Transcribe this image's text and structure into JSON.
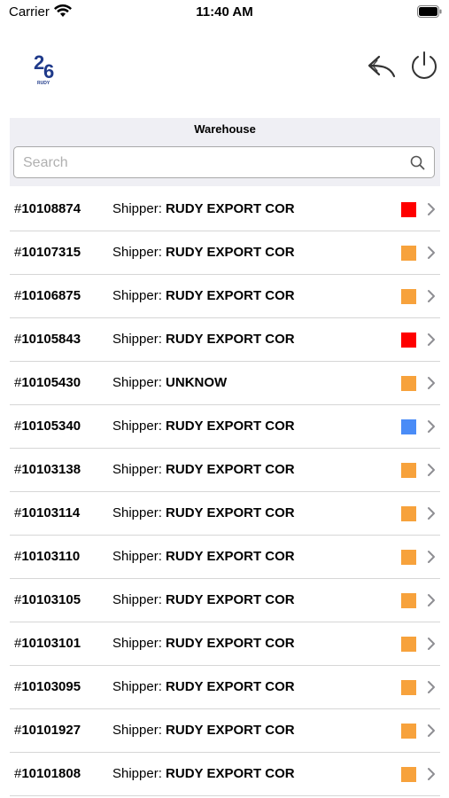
{
  "status_bar": {
    "carrier": "Carrier",
    "time": "11:40 AM"
  },
  "logo": {
    "text": "26",
    "sub": "RUDY"
  },
  "header": {
    "icons": [
      "reply-arrow-icon",
      "power-icon"
    ]
  },
  "section": {
    "title": "Warehouse"
  },
  "search": {
    "placeholder": "Search",
    "value": ""
  },
  "list": {
    "shipper_label": "Shipper:",
    "items": [
      {
        "hash": "#",
        "number": "10108874",
        "shipper": "RUDY EXPORT COR",
        "color": "#ff0000"
      },
      {
        "hash": "#",
        "number": "10107315",
        "shipper": "RUDY EXPORT COR",
        "color": "#f7a23c"
      },
      {
        "hash": "#",
        "number": "10106875",
        "shipper": "RUDY EXPORT COR",
        "color": "#f7a23c"
      },
      {
        "hash": "#",
        "number": "10105843",
        "shipper": "RUDY EXPORT COR",
        "color": "#ff0000"
      },
      {
        "hash": "#",
        "number": "10105430",
        "shipper": "UNKNOW",
        "color": "#f7a23c"
      },
      {
        "hash": "#",
        "number": "10105340",
        "shipper": "RUDY EXPORT COR",
        "color": "#4a8cf7"
      },
      {
        "hash": "#",
        "number": "10103138",
        "shipper": "RUDY EXPORT COR",
        "color": "#f7a23c"
      },
      {
        "hash": "#",
        "number": "10103114",
        "shipper": "RUDY EXPORT COR",
        "color": "#f7a23c"
      },
      {
        "hash": "#",
        "number": "10103110",
        "shipper": "RUDY EXPORT COR",
        "color": "#f7a23c"
      },
      {
        "hash": "#",
        "number": "10103105",
        "shipper": "RUDY EXPORT COR",
        "color": "#f7a23c"
      },
      {
        "hash": "#",
        "number": "10103101",
        "shipper": "RUDY EXPORT COR",
        "color": "#f7a23c"
      },
      {
        "hash": "#",
        "number": "10103095",
        "shipper": "RUDY EXPORT COR",
        "color": "#f7a23c"
      },
      {
        "hash": "#",
        "number": "10101927",
        "shipper": "RUDY EXPORT COR",
        "color": "#f7a23c"
      },
      {
        "hash": "#",
        "number": "10101808",
        "shipper": "RUDY EXPORT COR",
        "color": "#f7a23c"
      }
    ]
  }
}
